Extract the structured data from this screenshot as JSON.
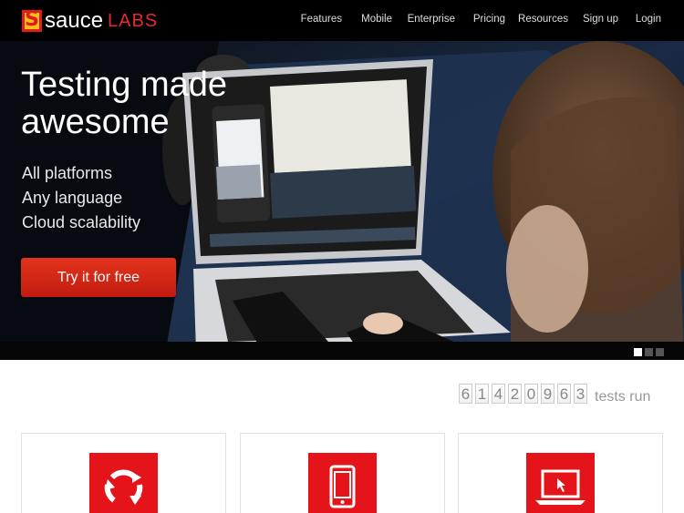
{
  "header": {
    "logo_mark": "S",
    "logo_sauce": "sauce",
    "logo_labs": "LABS",
    "nav": [
      "Features",
      "Mobile",
      "Enterprise",
      "Pricing",
      "Resources",
      "Sign up",
      "Login"
    ]
  },
  "hero": {
    "title": "Testing made awesome",
    "lines": [
      "All platforms",
      "Any language",
      "Cloud scalability"
    ],
    "cta": "Try it for free",
    "slides": 3,
    "active_slide": 1
  },
  "counter": {
    "digits": [
      "6",
      "1",
      "4",
      "2",
      "0",
      "9",
      "6",
      "3"
    ],
    "label": "tests run"
  },
  "features": [
    {
      "icon": "refresh-icon"
    },
    {
      "icon": "tablet-icon"
    },
    {
      "icon": "laptop-icon"
    }
  ],
  "colors": {
    "brand_red": "#e5141a",
    "header_bg": "#000000",
    "logo_yellow": "#f4c21b"
  }
}
